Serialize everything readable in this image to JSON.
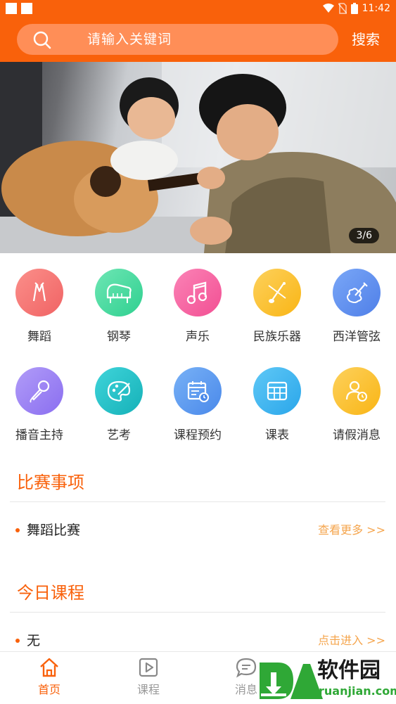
{
  "search": {
    "placeholder": "请输入关键词",
    "button_label": "搜索"
  },
  "status_bar": {
    "time": "11:42"
  },
  "banner": {
    "counter": "3/6"
  },
  "categories": [
    {
      "label": "舞蹈",
      "icon": "dance-icon",
      "color": "#f4716f"
    },
    {
      "label": "钢琴",
      "icon": "piano-icon",
      "color": "#3ed89b"
    },
    {
      "label": "声乐",
      "icon": "music-note-icon",
      "color": "#f865a3"
    },
    {
      "label": "民族乐器",
      "icon": "erhu-icon",
      "color": "#fbc531"
    },
    {
      "label": "西洋管弦",
      "icon": "violin-icon",
      "color": "#5d8ff2"
    },
    {
      "label": "播音主持",
      "icon": "microphone-icon",
      "color": "#9b82f4"
    },
    {
      "label": "艺考",
      "icon": "palette-icon",
      "color": "#25c2c9"
    },
    {
      "label": "课程预约",
      "icon": "calendar-clock-icon",
      "color": "#5a9cf0"
    },
    {
      "label": "课表",
      "icon": "timetable-icon",
      "color": "#3fb4ef"
    },
    {
      "label": "请假消息",
      "icon": "user-clock-icon",
      "color": "#fbc531"
    }
  ],
  "competition": {
    "title": "比赛事项",
    "item": "舞蹈比赛",
    "more": "查看更多 >>"
  },
  "today": {
    "title": "今日课程",
    "item": "无",
    "more": "点击进入 >>"
  },
  "bottom_nav": {
    "items": [
      {
        "label": "首页",
        "icon": "home-icon",
        "active": true
      },
      {
        "label": "课程",
        "icon": "play-icon",
        "active": false
      },
      {
        "label": "消息",
        "icon": "message-icon",
        "active": false
      }
    ],
    "active_color": "#f9610b",
    "inactive_color": "#999999"
  },
  "watermark": {
    "brand": "软件园",
    "domain": "ruanjian.com"
  }
}
